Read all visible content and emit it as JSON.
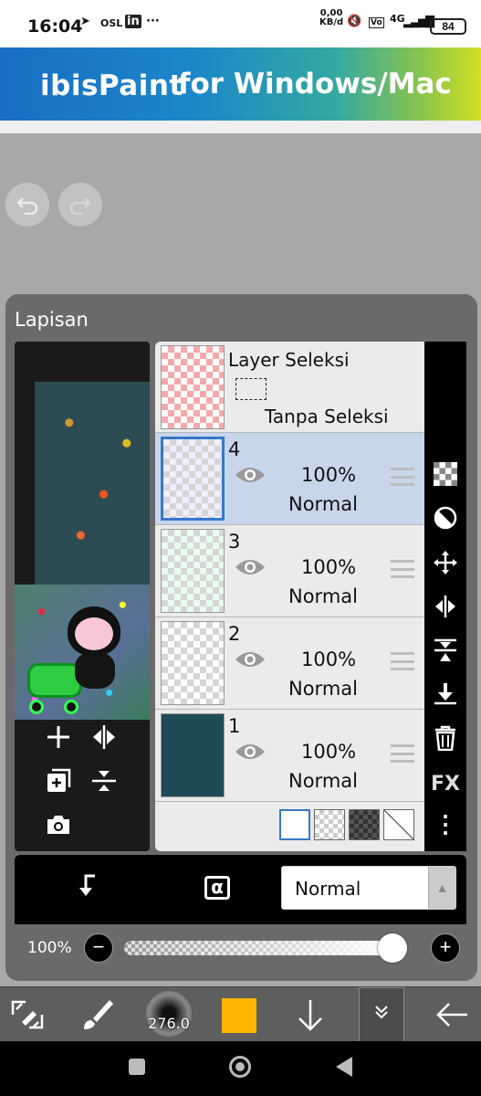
{
  "status_bar": {
    "time": "16:04",
    "carrier_label": "OSL",
    "speed_value": "0,00",
    "speed_unit": "KB/d",
    "network": "4G",
    "battery": "84"
  },
  "banner": {
    "logo": "ibisPaint",
    "tagline": "for Windows/Mac"
  },
  "panel": {
    "title": "Lapisan"
  },
  "selection_layer": {
    "title": "Layer Seleksi",
    "status": "Tanpa Seleksi"
  },
  "layers": [
    {
      "number": "4",
      "opacity": "100%",
      "blend": "Normal",
      "selected": true
    },
    {
      "number": "3",
      "opacity": "100%",
      "blend": "Normal",
      "selected": false
    },
    {
      "number": "2",
      "opacity": "100%",
      "blend": "Normal",
      "selected": false
    },
    {
      "number": "1",
      "opacity": "100%",
      "blend": "Normal",
      "selected": false
    }
  ],
  "blend_mode": {
    "value": "Normal",
    "alpha_lock_symbol": "α"
  },
  "opacity_control": {
    "label": "100%",
    "value": 1.0
  },
  "toolbar": {
    "brush_size": "276.0",
    "color": "#ffb600",
    "fx_label": "FX"
  },
  "icons": {
    "undo": "undo-icon",
    "redo": "redo-icon",
    "add_layer": "plus-icon",
    "flip": "flip-horizontal-icon",
    "camera": "camera-icon",
    "delete": "trash-icon"
  }
}
